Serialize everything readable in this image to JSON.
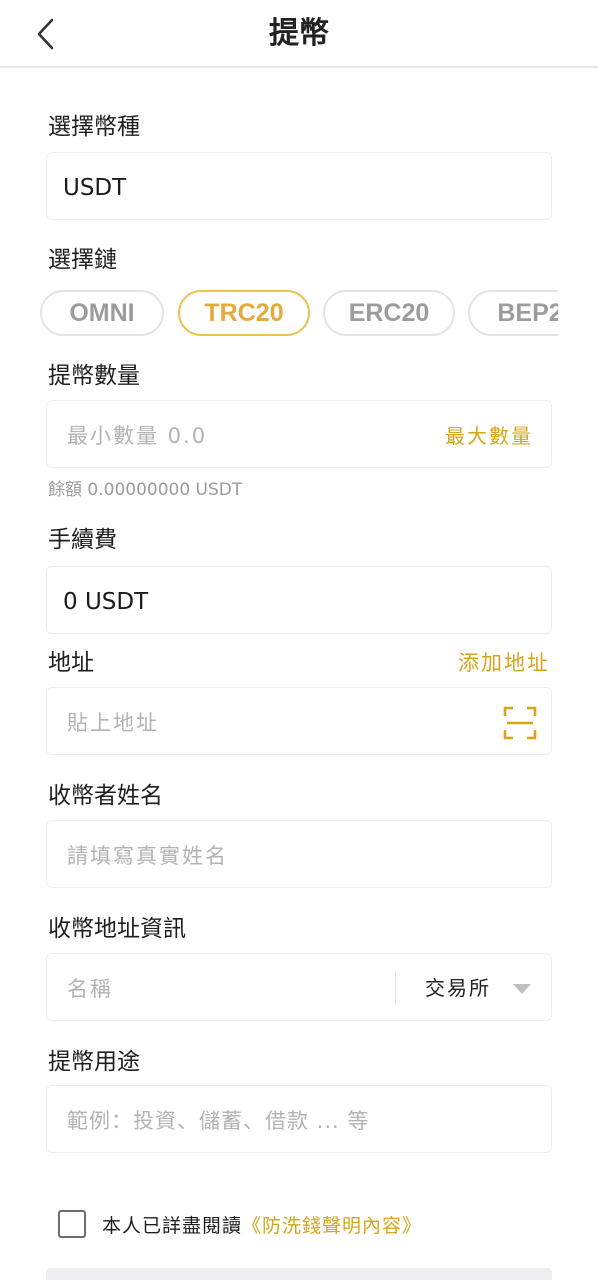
{
  "header": {
    "title": "提幣",
    "back_icon": "chevron-left-icon"
  },
  "currency": {
    "label": "選擇幣種",
    "value": "USDT"
  },
  "chain": {
    "label": "選擇鏈",
    "options": [
      "OMNI",
      "TRC20",
      "ERC20",
      "BEP2"
    ],
    "selected": "TRC20"
  },
  "amount": {
    "label": "提幣數量",
    "placeholder": "最小數量 0.0",
    "max_label": "最大數量",
    "balance": "餘額 0.00000000 USDT"
  },
  "fee": {
    "label": "手續費",
    "value": "0 USDT"
  },
  "address": {
    "label": "地址",
    "add_label": "添加地址",
    "placeholder": "貼上地址",
    "scan_icon": "scan-icon"
  },
  "recipient": {
    "label": "收幣者姓名",
    "placeholder": "請填寫真實姓名"
  },
  "address_info": {
    "label": "收幣地址資訊",
    "name_placeholder": "名稱",
    "type_value": "交易所"
  },
  "purpose": {
    "label": "提幣用途",
    "placeholder": "範例：投資、儲蓄、借款 ... 等"
  },
  "agreement": {
    "prefix": "本人已詳盡閱讀",
    "link": "《防洗錢聲明內容》"
  },
  "colors": {
    "accent": "#d6a51a",
    "chip_active_border": "#ecc24f",
    "chip_border": "#e3e3e3"
  }
}
